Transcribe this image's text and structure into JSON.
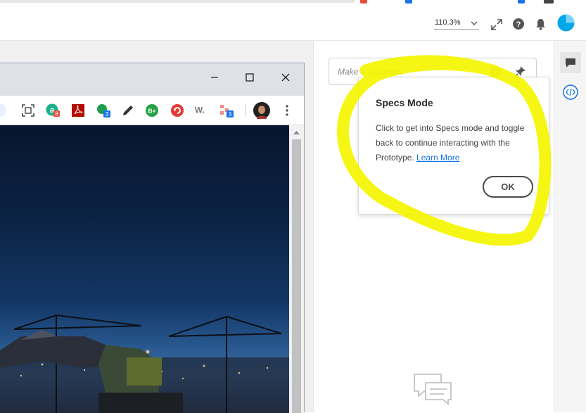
{
  "header": {
    "zoom_value": "110.3%"
  },
  "browser": {
    "extensions": [
      {
        "name": "a-extension-icon",
        "badge": "8",
        "badge_color": "#e74c3c"
      },
      {
        "name": "pdf-extension-icon",
        "badge": "",
        "badge_color": ""
      },
      {
        "name": "green-dot-extension-icon",
        "badge": "3",
        "badge_color": "#1a73e8"
      },
      {
        "name": "pencil-extension-icon",
        "badge": "",
        "badge_color": ""
      },
      {
        "name": "b-plus-extension-icon",
        "badge": "",
        "badge_color": ""
      },
      {
        "name": "refresh-extension-icon",
        "badge": "",
        "badge_color": ""
      },
      {
        "name": "w-extension-icon",
        "badge": "",
        "badge_color": ""
      },
      {
        "name": "share-extension-icon",
        "badge": "3",
        "badge_color": "#1a73e8"
      }
    ],
    "ext_labels": {
      "a": "a",
      "b": "B+",
      "w": "W."
    }
  },
  "comment": {
    "placeholder": "Make a comment",
    "at_symbol": "@"
  },
  "popover": {
    "title": "Specs Mode",
    "body": "Click to get into Specs mode and toggle back to continue interacting with the Prototype.",
    "link": "Learn More",
    "ok_label": "OK"
  },
  "colors": {
    "highlight": "#f5f500",
    "accent": "#1473e6",
    "avatar": "#00a8e8"
  }
}
